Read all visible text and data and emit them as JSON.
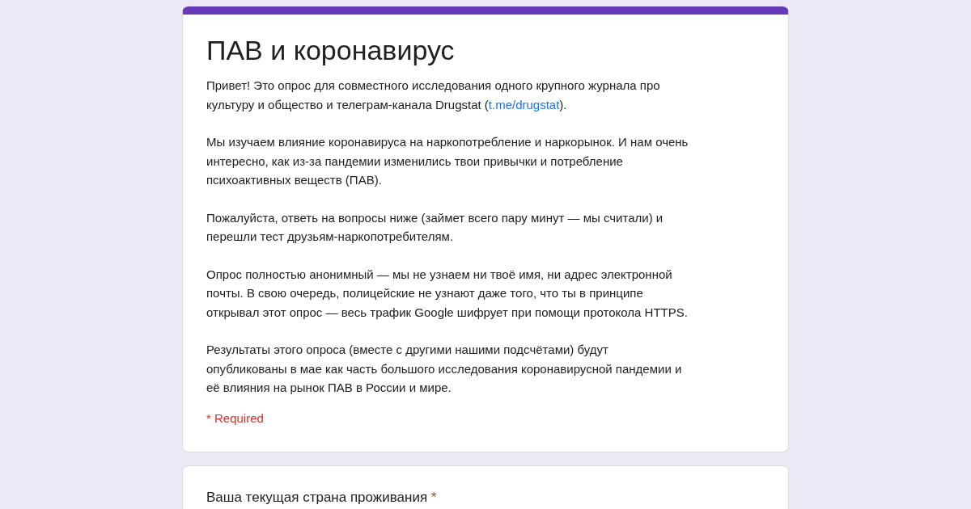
{
  "form": {
    "title": "ПАВ и коронавирус",
    "paragraphs": [
      {
        "lines": [
          [
            {
              "kind": "text",
              "text": "Привет! Это опрос для совместного исследования одного крупного журнала про"
            }
          ],
          [
            {
              "kind": "text",
              "text": "культуру и общество и телеграм-канала Drugstat ("
            },
            {
              "kind": "link",
              "text": "t.me/drugstat"
            },
            {
              "kind": "text",
              "text": ")."
            }
          ]
        ]
      },
      {
        "lines": [
          [
            {
              "kind": "text",
              "text": "Мы изучаем влияние коронавируса на наркопотребление и наркорынок. И нам очень"
            }
          ],
          [
            {
              "kind": "text",
              "text": "интересно, как из-за пандемии изменились твои привычки и потребление"
            }
          ],
          [
            {
              "kind": "text",
              "text": "психоактивных веществ (ПАВ)."
            }
          ]
        ]
      },
      {
        "lines": [
          [
            {
              "kind": "text",
              "text": "Пожалуйста, ответь на вопросы ниже (займет всего пару минут — мы считали) и"
            }
          ],
          [
            {
              "kind": "text",
              "text": "перешли тест друзьям-наркопотребителям."
            }
          ]
        ]
      },
      {
        "lines": [
          [
            {
              "kind": "text",
              "text": "Опрос полностью анонимный — мы не узнаем ни твоё имя, ни адрес электронной"
            }
          ],
          [
            {
              "kind": "text",
              "text": "почты. В свою очередь, полицейские не узнают даже того, что ты в принципе"
            }
          ],
          [
            {
              "kind": "text",
              "text": "открывал этот опрос — весь трафик Google шифрует при помощи протокола HTTPS."
            }
          ]
        ]
      },
      {
        "lines": [
          [
            {
              "kind": "text",
              "text": "Результаты этого опроса (вместе с другими нашими подсчётами) будут"
            }
          ],
          [
            {
              "kind": "text",
              "text": "опубликованы в мае как часть большого исследования коронавирусной пандемии и"
            }
          ],
          [
            {
              "kind": "text",
              "text": "её влияния на рынок ПАВ в России и мире."
            }
          ]
        ]
      }
    ],
    "required_note": "* Required"
  },
  "question": {
    "label": "Ваша текущая страна проживания",
    "required_mark": "*"
  }
}
